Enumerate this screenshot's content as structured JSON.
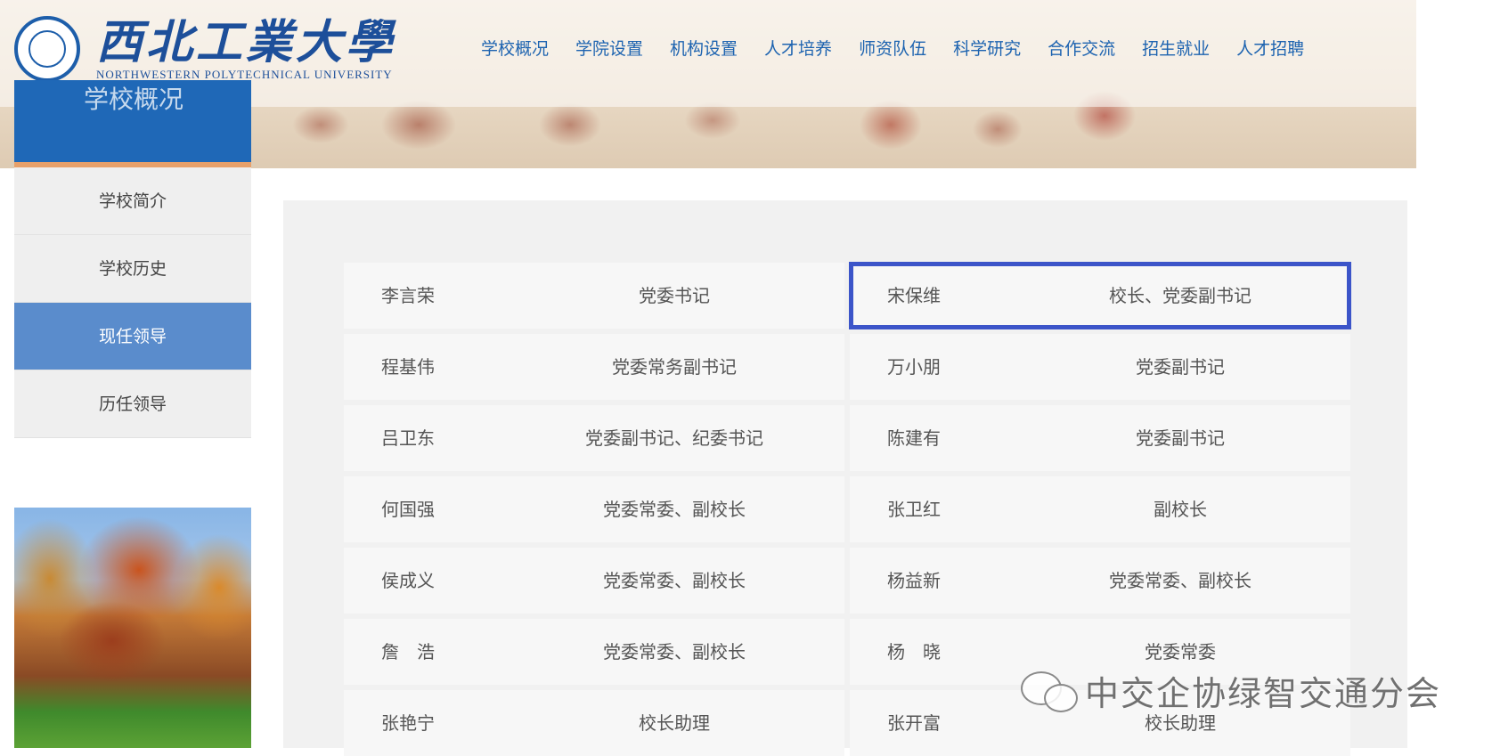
{
  "header": {
    "logo_cn": "西北工業大學",
    "logo_en": "NORTHWESTERN POLYTECHNICAL UNIVERSITY",
    "nav": [
      "学校概况",
      "学院设置",
      "机构设置",
      "人才培养",
      "师资队伍",
      "科学研究",
      "合作交流",
      "招生就业",
      "人才招聘"
    ]
  },
  "sidebar": {
    "title": "学校概况",
    "items": [
      {
        "label": "学校简介"
      },
      {
        "label": "学校历史"
      },
      {
        "label": "现任领导",
        "active": true
      },
      {
        "label": "历任领导"
      }
    ]
  },
  "leaders": [
    {
      "name": "李言荣",
      "title": "党委书记"
    },
    {
      "name": "宋保维",
      "title": "校长、党委副书记",
      "highlighted": true
    },
    {
      "name": "程基伟",
      "title": "党委常务副书记"
    },
    {
      "name": "万小朋",
      "title": "党委副书记"
    },
    {
      "name": "吕卫东",
      "title": "党委副书记、纪委书记"
    },
    {
      "name": "陈建有",
      "title": "党委副书记"
    },
    {
      "name": "何国强",
      "title": "党委常委、副校长"
    },
    {
      "name": "张卫红",
      "title": "副校长"
    },
    {
      "name": "侯成义",
      "title": "党委常委、副校长"
    },
    {
      "name": "杨益新",
      "title": "党委常委、副校长"
    },
    {
      "name": "詹　浩",
      "title": "党委常委、副校长"
    },
    {
      "name": "杨　晓",
      "title": "党委常委"
    },
    {
      "name": "张艳宁",
      "title": "校长助理"
    },
    {
      "name": "张开富",
      "title": "校长助理"
    }
  ],
  "watermark": {
    "text": "中交企协绿智交通分会",
    "icon": "wechat-icon"
  },
  "colors": {
    "nav_text": "#1d63b0",
    "sidebar_head": "#1f68b7",
    "sidebar_active": "#5a8ccc",
    "highlight_border": "#3c55c9"
  }
}
